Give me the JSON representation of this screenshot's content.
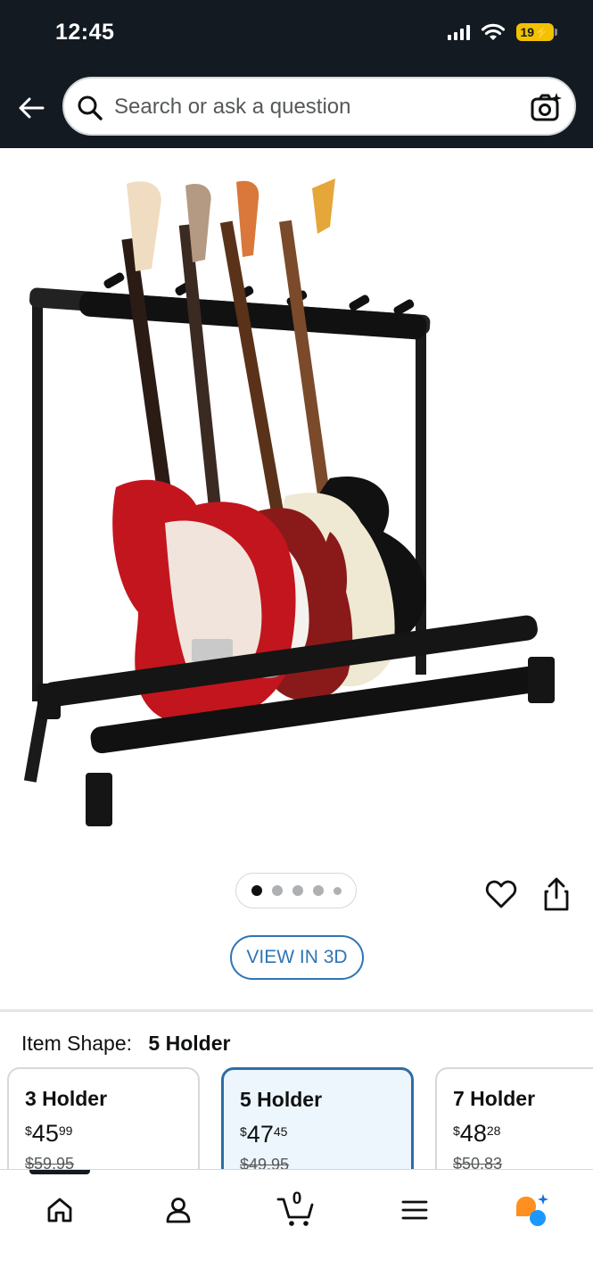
{
  "status_bar": {
    "time": "12:45",
    "battery": "19"
  },
  "header": {
    "search_placeholder": "Search or ask a question",
    "icons": [
      "back-arrow-icon",
      "search-icon",
      "camera-icon"
    ]
  },
  "gallery": {
    "image_count": 5,
    "active_index": 0,
    "view_3d_label": "VIEW IN 3D"
  },
  "item_shape": {
    "label": "Item Shape:",
    "selected": "5 Holder",
    "options": [
      {
        "name": "3 Holder",
        "currency": "$",
        "whole": "45",
        "fraction": "99",
        "list_price": "$59.95"
      },
      {
        "name": "5 Holder",
        "currency": "$",
        "whole": "47",
        "fraction": "45",
        "list_price": "$49.95"
      },
      {
        "name": "7 Holder",
        "currency": "$",
        "whole": "48",
        "fraction": "28",
        "list_price": "$50.83"
      }
    ]
  },
  "bottom_nav": {
    "cart_count": "0",
    "items": [
      "home-icon",
      "account-icon",
      "cart-icon",
      "menu-icon",
      "rufus-icon"
    ]
  },
  "colors": {
    "header_bg": "#131a22",
    "link_blue": "#2f74b5",
    "selected_border": "#2f6da3",
    "rufus_orange": "#ff8f1f",
    "rufus_blue": "#1a98ff"
  }
}
